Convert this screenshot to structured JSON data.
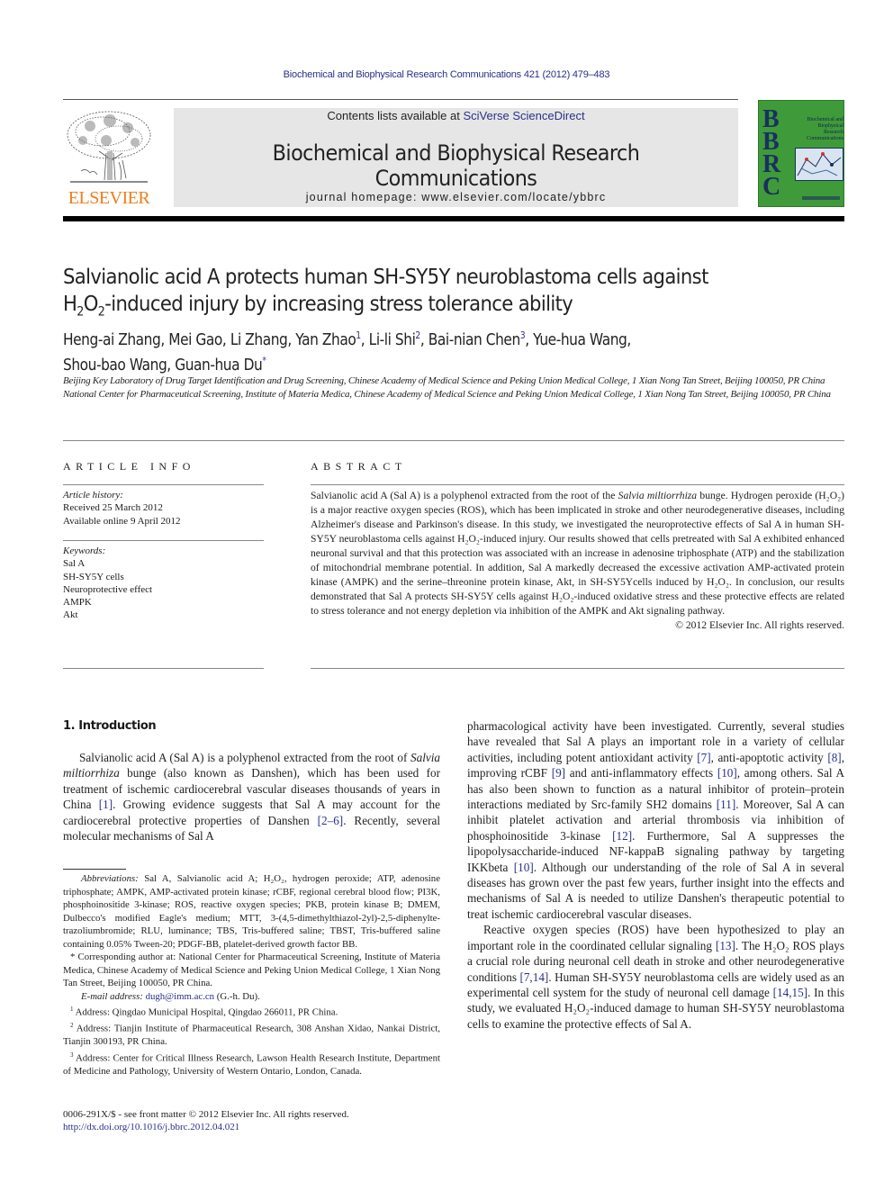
{
  "header": {
    "running_citation": "Biochemical and Biophysical Research Communications 421 (2012) 479–483",
    "contents_prefix": "Contents lists available at ",
    "contents_link": "SciVerse ScienceDirect",
    "journal_title": "Biochemical and Biophysical Research Communications",
    "homepage": "journal homepage: www.elsevier.com/locate/ybbrc",
    "publisher_logo_text": "ELSEVIER",
    "cover": {
      "letters": [
        "B",
        "B",
        "R",
        "C"
      ],
      "title_lines": [
        "Biochemical and",
        "Biophysical",
        "Research",
        "Communications"
      ],
      "background_color": "#3f9b3a"
    }
  },
  "article": {
    "title_line1": "Salvianolic acid A protects human SH-SY5Y neuroblastoma cells against",
    "title_line2_pre": "H",
    "title_line2_sub1": "2",
    "title_line2_mid": "O",
    "title_line2_sub2": "2",
    "title_line2_post": "-induced injury by increasing stress tolerance ability",
    "authors": [
      {
        "name": "Heng-ai Zhang",
        "mark": ""
      },
      {
        "name": "Mei Gao",
        "mark": ""
      },
      {
        "name": "Li Zhang",
        "mark": ""
      },
      {
        "name": "Yan Zhao",
        "mark": "1"
      },
      {
        "name": "Li-li Shi",
        "mark": "2"
      },
      {
        "name": "Bai-nian Chen",
        "mark": "3"
      },
      {
        "name": "Yue-hua Wang",
        "mark": ""
      },
      {
        "name": "Shou-bao Wang",
        "mark": ""
      },
      {
        "name": "Guan-hua Du",
        "mark": "*"
      }
    ],
    "affiliations": [
      "Beijing Key Laboratory of Drug Target Identification and Drug Screening, Chinese Academy of Medical Science and Peking Union Medical College, 1 Xian Nong Tan Street, Beijing 100050, PR China",
      "National Center for Pharmaceutical Screening, Institute of Materia Medica, Chinese Academy of Medical Science and Peking Union Medical College, 1 Xian Nong Tan Street, Beijing 100050, PR China"
    ]
  },
  "article_info": {
    "heading": "ARTICLE INFO",
    "history_label": "Article history:",
    "received": "Received 25 March 2012",
    "available": "Available online 9 April 2012",
    "keywords_label": "Keywords:",
    "keywords": [
      "Sal A",
      "SH-SY5Y cells",
      "Neuroprotective effect",
      "AMPK",
      "Akt"
    ]
  },
  "abstract": {
    "heading": "ABSTRACT",
    "s1_pre": "Salvianolic acid A (Sal A) is a polyphenol extracted from the root of the ",
    "s1_ital": "Salvia miltiorrhiza",
    "s1_post": " bunge. Hydrogen peroxide (H₂O₂) is a major reactive oxygen species (ROS), which has been implicated in stroke and other neurodegenerative diseases, including Alzheimer's disease and Parkinson's disease. In this study, we investigated the neuroprotective effects of Sal A in human SH-SY5Y neuroblastoma cells against H₂O₂-induced injury. Our results showed that cells pretreated with Sal A exhibited enhanced neuronal survival and that this protection was associated with an increase in adenosine triphosphate (ATP) and the stabilization of mitochondrial membrane potential. In addition, Sal A markedly decreased the excessive activation AMP-activated protein kinase (AMPK) and the serine–threonine protein kinase, Akt, in SH-SY5Ycells induced by H₂O₂. In conclusion, our results demonstrated that Sal A protects SH-SY5Y cells against H₂O₂-induced oxidative stress and these protective effects are related to stress tolerance and not energy depletion via inhibition of the AMPK and Akt signaling pathway.",
    "copyright": "© 2012 Elsevier Inc. All rights reserved."
  },
  "introduction": {
    "heading": "1. Introduction",
    "p1": [
      {
        "t": "Salvianolic acid A (Sal A) is a polyphenol extracted from the root of "
      },
      {
        "t": "Salvia miltiorrhiza",
        "style": "italic"
      },
      {
        "t": " bunge (also known as Danshen), which has been used for treatment of ischemic cardiocerebral vascular diseases thousands of years in China "
      },
      {
        "t": "[1]",
        "style": "ref"
      },
      {
        "t": ". Growing evidence suggests that Sal A may account for the cardiocerebral protective properties of Danshen "
      },
      {
        "t": "[2–6]",
        "style": "ref"
      },
      {
        "t": ". Recently, several molecular mechanisms of Sal A pharmacological activity have been investigated. Currently, several studies have revealed that Sal A plays an important role in a variety of cellular activities, including potent antioxidant activity "
      },
      {
        "t": "[7]",
        "style": "ref"
      },
      {
        "t": ", anti-apoptotic activity "
      },
      {
        "t": "[8]",
        "style": "ref"
      },
      {
        "t": ", improving rCBF "
      },
      {
        "t": "[9]",
        "style": "ref"
      },
      {
        "t": " and anti-inflammatory effects "
      },
      {
        "t": "[10]",
        "style": "ref"
      },
      {
        "t": ", among others. Sal A has also been shown to function as a natural inhibitor of protein–protein interactions mediated by Src-family SH2 domains "
      },
      {
        "t": "[11]",
        "style": "ref"
      },
      {
        "t": ". Moreover, Sal A can inhibit platelet activation and arterial thrombosis via inhibition of phosphoinositide 3-kinase "
      },
      {
        "t": "[12]",
        "style": "ref"
      },
      {
        "t": ". Furthermore, Sal A suppresses the lipopolysaccharide-induced NF-kappaB signaling pathway by targeting IKKbeta "
      },
      {
        "t": "[10]",
        "style": "ref"
      },
      {
        "t": ". Although our understanding of the role of Sal A in several diseases has grown over the past few years, further insight into the effects and mechanisms of Sal A is needed to utilize Danshen's therapeutic potential to treat ischemic cardiocerebral vascular diseases."
      }
    ],
    "left_column_text": [
      {
        "t": "Salvianolic acid A (Sal A) is a polyphenol extracted from the root of "
      },
      {
        "t": "Salvia miltiorrhiza",
        "style": "italic"
      },
      {
        "t": " bunge (also known as Danshen), which has been used for treatment of ischemic cardiocerebral vascular diseases thousands of years in China "
      },
      {
        "t": "[1]",
        "style": "ref"
      },
      {
        "t": ". Growing evidence suggests that Sal A may account for the cardiocerebral protective properties of Danshen "
      },
      {
        "t": "[2–6]",
        "style": "ref"
      },
      {
        "t": ". Recently, several molecular mechanisms of Sal A"
      }
    ],
    "right_column_cont": [
      {
        "t": "pharmacological activity have been investigated. Currently, several studies have revealed that Sal A plays an important role in a variety of cellular activities, including potent antioxidant activity "
      },
      {
        "t": "[7]",
        "style": "ref"
      },
      {
        "t": ", anti-apoptotic activity "
      },
      {
        "t": "[8]",
        "style": "ref"
      },
      {
        "t": ", improving rCBF "
      },
      {
        "t": "[9]",
        "style": "ref"
      },
      {
        "t": " and anti-inflammatory effects "
      },
      {
        "t": "[10]",
        "style": "ref"
      },
      {
        "t": ", among others. Sal A has also been shown to function as a natural inhibitor of protein–protein interactions mediated by Src-family SH2 domains "
      },
      {
        "t": "[11]",
        "style": "ref"
      },
      {
        "t": ". Moreover, Sal A can inhibit platelet activation and arterial thrombosis via inhibition of phosphoinositide 3-kinase "
      },
      {
        "t": "[12]",
        "style": "ref"
      },
      {
        "t": ". Furthermore, Sal A suppresses the lipopolysaccharide-induced NF-kappaB signaling pathway by targeting IKKbeta "
      },
      {
        "t": "[10]",
        "style": "ref"
      },
      {
        "t": ". Although our understanding of the role of Sal A in several diseases has grown over the past few years, further insight into the effects and mechanisms of Sal A is needed to utilize Danshen's therapeutic potential to treat ischemic cardiocerebral vascular diseases."
      }
    ],
    "p2": [
      {
        "t": "Reactive oxygen species (ROS) have been hypothesized to play an important role in the coordinated cellular signaling "
      },
      {
        "t": "[13]",
        "style": "ref"
      },
      {
        "t": ". The H₂O₂ ROS plays a crucial role during neuronal cell death in stroke and other neurodegenerative conditions "
      },
      {
        "t": "[7,14]",
        "style": "ref"
      },
      {
        "t": ". Human SH-SY5Y neuroblastoma cells are widely used as an experimental cell system for the study of neuronal cell damage "
      },
      {
        "t": "[14,15]",
        "style": "ref"
      },
      {
        "t": ". In this study, we evaluated H₂O₂-induced damage to human SH-SY5Y neuroblastoma cells to examine the protective effects of Sal A."
      }
    ]
  },
  "footnotes": {
    "abbreviations_label": "Abbreviations:",
    "abbreviations": " Sal A, Salvianolic acid A; H₂O₂, hydrogen peroxide; ATP, adenosine triphosphate; AMPK, AMP-activated protein kinase; rCBF, regional cerebral blood flow; PI3K, phosphoinositide 3-kinase; ROS, reactive oxygen species; PKB, protein kinase B; DMEM, Dulbecco's modified Eagle's medium; MTT, 3-(4,5-dimethylthiazol-2yl)-2,5-diphenylte-trazoliumbromide; RLU, luminance; TBS, Tris-buffered saline; TBST, Tris-buffered saline containing 0.05% Tween-20; PDGF-BB, platelet-derived growth factor BB.",
    "corresponding": "* Corresponding author at: National Center for Pharmaceutical Screening, Institute of Materia Medica, Chinese Academy of Medical Science and Peking Union Medical College, 1 Xian Nong Tan Street, Beijing 100050, PR China.",
    "email_label": "E-mail address:",
    "email": "dugh@imm.ac.cn",
    "email_suffix": " (G.-h. Du).",
    "notes": [
      {
        "mark": "1",
        "text": " Address: Qingdao Municipal Hospital, Qingdao 266011, PR China."
      },
      {
        "mark": "2",
        "text": " Address: Tianjin Institute of Pharmaceutical Research, 308 Anshan Xidao, Nankai District, Tianjin 300193, PR China."
      },
      {
        "mark": "3",
        "text": " Address: Center for Critical Illness Research, Lawson Health Research Institute, Department of Medicine and Pathology, University of Western Ontario, London, Canada."
      }
    ]
  },
  "front_matter": {
    "issn_line": "0006-291X/$ - see front matter © 2012 Elsevier Inc. All rights reserved.",
    "doi": "http://dx.doi.org/10.1016/j.bbrc.2012.04.021"
  },
  "colors": {
    "link": "#2a2f8a",
    "elsevier_orange": "#f07d1a",
    "masthead_gray": "#e6e6e6"
  }
}
